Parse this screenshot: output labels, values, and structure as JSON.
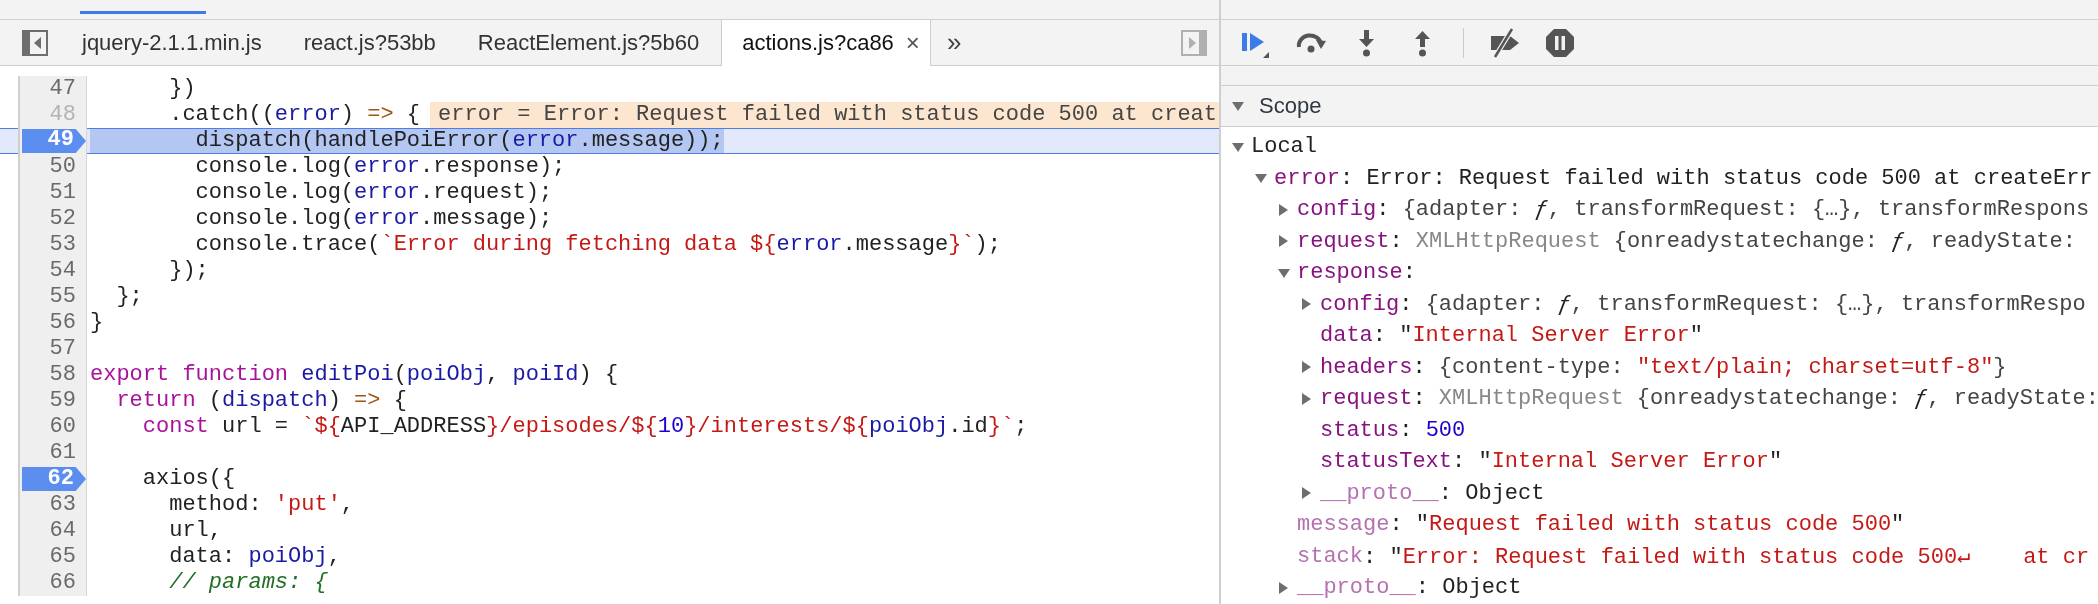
{
  "editor": {
    "tabs": [
      {
        "label": "jquery-2.1.1.min.js",
        "selected": false
      },
      {
        "label": "react.js?53bb",
        "selected": false
      },
      {
        "label": "ReactElement.js?5b60",
        "selected": false
      },
      {
        "label": "actions.js?ca86",
        "selected": true,
        "close": "×"
      }
    ],
    "overflow_button": "»",
    "lines": [
      {
        "number": "47",
        "breakpoint": false,
        "current": false,
        "dimmed": false,
        "tokens": [
          {
            "kind": "plain",
            "text": "      })"
          }
        ]
      },
      {
        "number": "48",
        "breakpoint": false,
        "current": false,
        "dimmed": true,
        "tokens": [
          {
            "kind": "plain",
            "text": "      .catch(("
          },
          {
            "kind": "var",
            "text": "error"
          },
          {
            "kind": "plain",
            "text": ") "
          },
          {
            "kind": "op",
            "text": "=>"
          },
          {
            "kind": "plain",
            "text": " {"
          }
        ],
        "inline_value": "error = Error: Request failed with status code 500 at creat"
      },
      {
        "number": "49",
        "breakpoint": true,
        "current": true,
        "dimmed": false,
        "tokens": [
          {
            "kind": "plain",
            "text": "        dispatch(handlePoiError("
          },
          {
            "kind": "var",
            "text": "error"
          },
          {
            "kind": "plain",
            "text": ".message));"
          }
        ]
      },
      {
        "number": "50",
        "breakpoint": false,
        "current": false,
        "dimmed": false,
        "tokens": [
          {
            "kind": "plain",
            "text": "        console.log("
          },
          {
            "kind": "var",
            "text": "error"
          },
          {
            "kind": "plain",
            "text": ".response);"
          }
        ]
      },
      {
        "number": "51",
        "breakpoint": false,
        "current": false,
        "dimmed": false,
        "tokens": [
          {
            "kind": "plain",
            "text": "        console.log("
          },
          {
            "kind": "var",
            "text": "error"
          },
          {
            "kind": "plain",
            "text": ".request);"
          }
        ]
      },
      {
        "number": "52",
        "breakpoint": false,
        "current": false,
        "dimmed": false,
        "tokens": [
          {
            "kind": "plain",
            "text": "        console.log("
          },
          {
            "kind": "var",
            "text": "error"
          },
          {
            "kind": "plain",
            "text": ".message);"
          }
        ]
      },
      {
        "number": "53",
        "breakpoint": false,
        "current": false,
        "dimmed": false,
        "tokens": [
          {
            "kind": "plain",
            "text": "        console.trace("
          },
          {
            "kind": "string",
            "text": "`Error during fetching data ${"
          },
          {
            "kind": "var",
            "text": "error"
          },
          {
            "kind": "plain",
            "text": ".message"
          },
          {
            "kind": "string",
            "text": "}`"
          },
          {
            "kind": "plain",
            "text": ");"
          }
        ]
      },
      {
        "number": "54",
        "breakpoint": false,
        "current": false,
        "dimmed": false,
        "tokens": [
          {
            "kind": "plain",
            "text": "      });"
          }
        ]
      },
      {
        "number": "55",
        "breakpoint": false,
        "current": false,
        "dimmed": false,
        "tokens": [
          {
            "kind": "plain",
            "text": "  };"
          }
        ]
      },
      {
        "number": "56",
        "breakpoint": false,
        "current": false,
        "dimmed": false,
        "tokens": [
          {
            "kind": "plain",
            "text": "}"
          }
        ]
      },
      {
        "number": "57",
        "breakpoint": false,
        "current": false,
        "dimmed": false
      },
      {
        "number": "58",
        "breakpoint": false,
        "current": false,
        "dimmed": false,
        "tokens": [
          {
            "kind": "keyword",
            "text": "export function "
          },
          {
            "kind": "var",
            "text": "editPoi"
          },
          {
            "kind": "plain",
            "text": "("
          },
          {
            "kind": "var",
            "text": "poiObj"
          },
          {
            "kind": "plain",
            "text": ", "
          },
          {
            "kind": "var",
            "text": "poiId"
          },
          {
            "kind": "plain",
            "text": ") {"
          }
        ]
      },
      {
        "number": "59",
        "breakpoint": false,
        "current": false,
        "dimmed": false,
        "tokens": [
          {
            "kind": "keyword",
            "text": "  return"
          },
          {
            "kind": "plain",
            "text": " ("
          },
          {
            "kind": "var",
            "text": "dispatch"
          },
          {
            "kind": "plain",
            "text": ") "
          },
          {
            "kind": "op",
            "text": "=>"
          },
          {
            "kind": "plain",
            "text": " {"
          }
        ]
      },
      {
        "number": "60",
        "breakpoint": false,
        "current": false,
        "dimmed": false,
        "tokens": [
          {
            "kind": "keyword",
            "text": "    const"
          },
          {
            "kind": "plain",
            "text": " url = "
          },
          {
            "kind": "string",
            "text": "`${"
          },
          {
            "kind": "plain",
            "text": "API_ADDRESS"
          },
          {
            "kind": "string",
            "text": "}/episodes/${"
          },
          {
            "kind": "number",
            "text": "10"
          },
          {
            "kind": "string",
            "text": "}/interests/${"
          },
          {
            "kind": "var",
            "text": "poiObj"
          },
          {
            "kind": "plain",
            "text": ".id"
          },
          {
            "kind": "string",
            "text": "}`"
          },
          {
            "kind": "plain",
            "text": ";"
          }
        ]
      },
      {
        "number": "61",
        "breakpoint": false,
        "current": false,
        "dimmed": false
      },
      {
        "number": "62",
        "breakpoint": true,
        "current": false,
        "dimmed": false,
        "tokens": [
          {
            "kind": "plain",
            "text": "    axios({"
          }
        ]
      },
      {
        "number": "63",
        "breakpoint": false,
        "current": false,
        "dimmed": false,
        "tokens": [
          {
            "kind": "plain",
            "text": "      method: "
          },
          {
            "kind": "string",
            "text": "'put'"
          },
          {
            "kind": "plain",
            "text": ","
          }
        ]
      },
      {
        "number": "64",
        "breakpoint": false,
        "current": false,
        "dimmed": false,
        "tokens": [
          {
            "kind": "plain",
            "text": "      url,"
          }
        ]
      },
      {
        "number": "65",
        "breakpoint": false,
        "current": false,
        "dimmed": false,
        "tokens": [
          {
            "kind": "plain",
            "text": "      data: "
          },
          {
            "kind": "var",
            "text": "poiObj"
          },
          {
            "kind": "plain",
            "text": ","
          }
        ]
      },
      {
        "number": "66",
        "breakpoint": false,
        "current": false,
        "dimmed": false,
        "tokens": [
          {
            "kind": "comment",
            "text": "      // params: {"
          }
        ]
      }
    ]
  },
  "debugger": {
    "scope": {
      "title": "Scope",
      "expanded": true,
      "tree": [
        {
          "kind": "scope",
          "name": "Local",
          "expanded": true,
          "children": [
            {
              "kind": "group",
              "name": "error",
              "dim": false,
              "expanded": true,
              "value": [
                {
                  "kind": "plain",
                  "text": ": "
                },
                {
                  "kind": "plain",
                  "text": "Error: Request failed with status code 500 at createErr"
                }
              ],
              "children": [
                {
                  "kind": "group",
                  "name": "config",
                  "dim": false,
                  "expanded": false,
                  "value": [
                    {
                      "kind": "plain",
                      "text": ": "
                    },
                    {
                      "kind": "preview",
                      "text": "{adapter: "
                    },
                    {
                      "kind": "fn",
                      "text": "ƒ"
                    },
                    {
                      "kind": "preview",
                      "text": ", transformRequest: {…}, transformRespons"
                    }
                  ]
                },
                {
                  "kind": "group",
                  "name": "request",
                  "dim": false,
                  "expanded": false,
                  "value": [
                    {
                      "kind": "plain",
                      "text": ": "
                    },
                    {
                      "kind": "class",
                      "text": "XMLHttpRequest"
                    },
                    {
                      "kind": "preview",
                      "text": " {onreadystatechange: "
                    },
                    {
                      "kind": "fn",
                      "text": "ƒ"
                    },
                    {
                      "kind": "preview",
                      "text": ", readyState: "
                    }
                  ]
                },
                {
                  "kind": "group",
                  "name": "response",
                  "dim": false,
                  "expanded": true,
                  "value": [
                    {
                      "kind": "plain",
                      "text": ":"
                    }
                  ],
                  "children": [
                    {
                      "kind": "group",
                      "name": "config",
                      "dim": false,
                      "expanded": false,
                      "value": [
                        {
                          "kind": "plain",
                          "text": ": "
                        },
                        {
                          "kind": "preview",
                          "text": "{adapter: "
                        },
                        {
                          "kind": "fn",
                          "text": "ƒ"
                        },
                        {
                          "kind": "preview",
                          "text": ", transformRequest: {…}, transformRespo"
                        }
                      ]
                    },
                    {
                      "kind": "leaf",
                      "name": "data",
                      "dim": false,
                      "value": [
                        {
                          "kind": "plain",
                          "text": ": \""
                        },
                        {
                          "kind": "string",
                          "text": "Internal Server Error"
                        },
                        {
                          "kind": "plain",
                          "text": "\""
                        }
                      ]
                    },
                    {
                      "kind": "group",
                      "name": "headers",
                      "dim": false,
                      "expanded": false,
                      "value": [
                        {
                          "kind": "plain",
                          "text": ": "
                        },
                        {
                          "kind": "preview",
                          "text": "{content-type: "
                        },
                        {
                          "kind": "string",
                          "text": "\"text/plain; charset=utf-8\""
                        },
                        {
                          "kind": "preview",
                          "text": "}"
                        }
                      ]
                    },
                    {
                      "kind": "group",
                      "name": "request",
                      "dim": false,
                      "expanded": false,
                      "value": [
                        {
                          "kind": "plain",
                          "text": ": "
                        },
                        {
                          "kind": "class",
                          "text": "XMLHttpRequest"
                        },
                        {
                          "kind": "preview",
                          "text": " {onreadystatechange: "
                        },
                        {
                          "kind": "fn",
                          "text": "ƒ"
                        },
                        {
                          "kind": "preview",
                          "text": ", readyState:"
                        }
                      ]
                    },
                    {
                      "kind": "leaf",
                      "name": "status",
                      "dim": false,
                      "value": [
                        {
                          "kind": "plain",
                          "text": ": "
                        },
                        {
                          "kind": "number",
                          "text": "500"
                        }
                      ]
                    },
                    {
                      "kind": "leaf",
                      "name": "statusText",
                      "dim": false,
                      "value": [
                        {
                          "kind": "plain",
                          "text": ": \""
                        },
                        {
                          "kind": "string",
                          "text": "Internal Server Error"
                        },
                        {
                          "kind": "plain",
                          "text": "\""
                        }
                      ]
                    },
                    {
                      "kind": "group",
                      "name": "__proto__",
                      "dim": true,
                      "expanded": false,
                      "value": [
                        {
                          "kind": "plain",
                          "text": ": Object"
                        }
                      ]
                    }
                  ]
                },
                {
                  "kind": "leaf",
                  "name": "message",
                  "dim": true,
                  "value": [
                    {
                      "kind": "plain",
                      "text": ": \""
                    },
                    {
                      "kind": "string",
                      "text": "Request failed with status code 500"
                    },
                    {
                      "kind": "plain",
                      "text": "\""
                    }
                  ]
                },
                {
                  "kind": "leaf",
                  "name": "stack",
                  "dim": true,
                  "value": [
                    {
                      "kind": "plain",
                      "text": ": \""
                    },
                    {
                      "kind": "string",
                      "text": "Error: Request failed with status code 500↵    at cr"
                    }
                  ]
                },
                {
                  "kind": "group",
                  "name": "__proto__",
                  "dim": true,
                  "expanded": false,
                  "value": [
                    {
                      "kind": "plain",
                      "text": ": Object"
                    }
                  ]
                }
              ]
            }
          ]
        }
      ]
    }
  }
}
